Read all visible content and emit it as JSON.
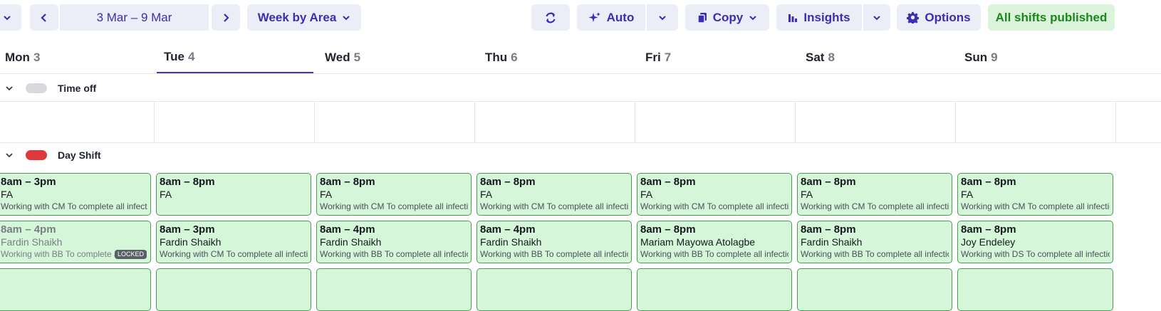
{
  "toolbar": {
    "date_range": "3 Mar – 9 Mar",
    "view_label": "Week by Area",
    "auto_label": "Auto",
    "copy_label": "Copy",
    "insights_label": "Insights",
    "options_label": "Options",
    "published_label": "All shifts published"
  },
  "days": [
    {
      "name": "Mon",
      "num": "3"
    },
    {
      "name": "Tue",
      "num": "4"
    },
    {
      "name": "Wed",
      "num": "5"
    },
    {
      "name": "Thu",
      "num": "6"
    },
    {
      "name": "Fri",
      "num": "7"
    },
    {
      "name": "Sat",
      "num": "8"
    },
    {
      "name": "Sun",
      "num": "9"
    }
  ],
  "groups": {
    "time_off": {
      "label": "Time off",
      "color": "#d8d9dd"
    },
    "day_shift": {
      "label": "Day Shift",
      "color": "#e0393b"
    }
  },
  "shifts": {
    "row1": [
      {
        "time": "8am – 3pm",
        "who": "FA",
        "note": "Working with CM To complete all infection"
      },
      {
        "time": "8am – 8pm",
        "who": "FA",
        "note": ""
      },
      {
        "time": "8am – 8pm",
        "who": "FA",
        "note": "Working with CM To complete all infection"
      },
      {
        "time": "8am – 8pm",
        "who": "FA",
        "note": "Working with CM To complete all infection"
      },
      {
        "time": "8am – 8pm",
        "who": "FA",
        "note": "Working with CM To complete all infection"
      },
      {
        "time": "8am – 8pm",
        "who": "FA",
        "note": "Working with CM To complete all infection"
      },
      {
        "time": "8am – 8pm",
        "who": "FA",
        "note": "Working with CM To complete all infection"
      }
    ],
    "row2": [
      {
        "time": "8am – 4pm",
        "who": "Fardin Shaikh",
        "note": "Working with BB To complete all infection",
        "badge": "LOCKED"
      },
      {
        "time": "8am – 3pm",
        "who": "Fardin Shaikh",
        "note": "Working with CM To complete all infection"
      },
      {
        "time": "8am – 4pm",
        "who": "Fardin Shaikh",
        "note": "Working with BB To complete all infection"
      },
      {
        "time": "8am – 4pm",
        "who": "Fardin Shaikh",
        "note": "Working with BB To complete all infection"
      },
      {
        "time": "8am – 8pm",
        "who": "Mariam Mayowa Atolagbe",
        "note": "Working with BB To complete all infection"
      },
      {
        "time": "8am – 8pm",
        "who": "Fardin Shaikh",
        "note": "Working with BB To complete all infection"
      },
      {
        "time": "8am – 8pm",
        "who": "Joy Endeley",
        "note": "Working with DS To complete all infection"
      }
    ]
  },
  "colors": {
    "accent": "#3b2db5",
    "shift_bg": "#d5f6d9",
    "shift_border": "#4c9b55",
    "published_bg": "#dcf3dc",
    "published_text": "#178a1a"
  }
}
